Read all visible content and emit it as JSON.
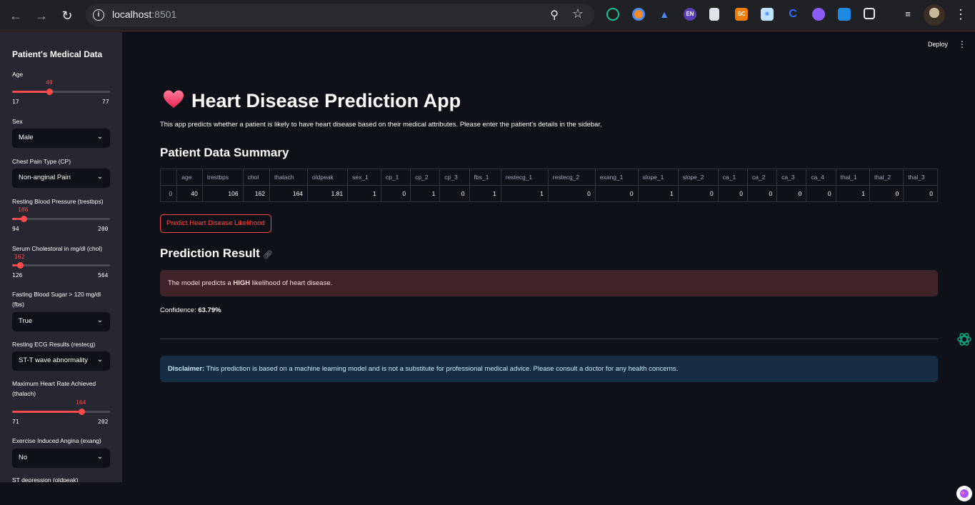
{
  "browser": {
    "url_host": "localhost",
    "url_port": ":8501",
    "extensions": [
      "grammarly-icon",
      "chrome-ext-icon",
      "graduation-cap-icon",
      "translate-en-icon",
      "document-icon",
      "sc-icon",
      "react-icon",
      "c-icon",
      "brain-icon",
      "paw-icon",
      "puzzle-icon"
    ],
    "ext_labels": {
      "en": "EN",
      "sc": "SC",
      "c": "C"
    }
  },
  "sidebar": {
    "title": "Patient's Medical Data",
    "age": {
      "label": "Age",
      "value": "40",
      "min": "17",
      "max": "77",
      "fraction": 0.383
    },
    "sex": {
      "label": "Sex",
      "value": "Male"
    },
    "cp": {
      "label": "Chest Pain Type (CP)",
      "value": "Non-anginal Pain"
    },
    "trestbps": {
      "label": "Resting Blood Pressure (trestbps)",
      "value": "106",
      "min": "94",
      "max": "200",
      "fraction": 0.113
    },
    "chol": {
      "label": "Serum Cholestoral in mg/dl (chol)",
      "value": "162",
      "min": "126",
      "max": "564",
      "fraction": 0.082
    },
    "fbs": {
      "label": "Fasting Blood Sugar > 120 mg/dl (fbs)",
      "value": "True"
    },
    "restecg": {
      "label": "Resting ECG Results (restecg)",
      "value": "ST-T wave abnormality"
    },
    "thalach": {
      "label": "Maximum Heart Rate Achieved (thalach)",
      "value": "164",
      "min": "71",
      "max": "202",
      "fraction": 0.71
    },
    "exang": {
      "label": "Exercise Induced Angina (exang)",
      "value": "No"
    },
    "oldpeak": {
      "label": "ST depression (oldpeak)"
    }
  },
  "main": {
    "deploy": "Deploy",
    "title": "Heart Disease Prediction App",
    "intro": "This app predicts whether a patient is likely to have heart disease based on their medical attributes. Please enter the patient's details in the sidebar.",
    "summary_heading": "Patient Data Summary",
    "table": {
      "columns": [
        "",
        "age",
        "trestbps",
        "chol",
        "thalach",
        "oldpeak",
        "sex_1",
        "cp_1",
        "cp_2",
        "cp_3",
        "fbs_1",
        "restecg_1",
        "restecg_2",
        "exang_1",
        "slope_1",
        "slope_2",
        "ca_1",
        "ca_2",
        "ca_3",
        "ca_4",
        "thal_1",
        "thal_2",
        "thal_3"
      ],
      "rows": [
        [
          "0",
          "40",
          "106",
          "162",
          "164",
          "1.81",
          "1",
          "0",
          "1",
          "0",
          "1",
          "1",
          "0",
          "0",
          "1",
          "0",
          "0",
          "0",
          "0",
          "0",
          "1",
          "0",
          "0"
        ]
      ]
    },
    "predict_button": "Predict Heart Disease Likelihood",
    "result_heading": "Prediction Result",
    "result_prefix": "The model predicts a ",
    "result_strong": "HIGH",
    "result_suffix": " likelihood of heart disease.",
    "confidence_label": "Confidence: ",
    "confidence_value": "63.79%",
    "disclaimer_strong": "Disclaimer:",
    "disclaimer_text": " This prediction is based on a machine learning model and is not a substitute for professional medical advice. Please consult a doctor for any health concerns."
  }
}
